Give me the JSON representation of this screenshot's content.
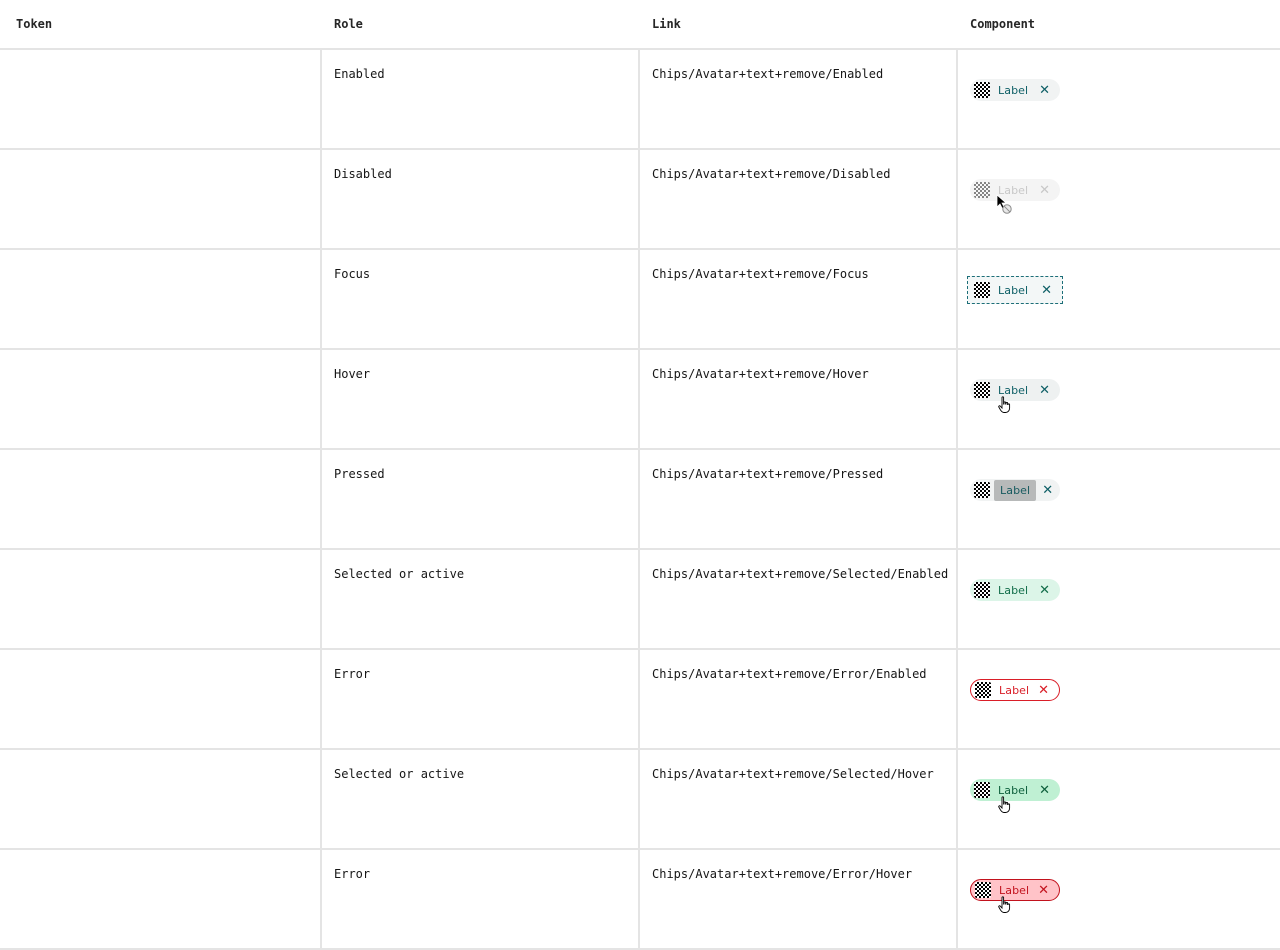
{
  "header": {
    "token": "Token",
    "role": "Role",
    "link": "Link",
    "component": "Component"
  },
  "rows": [
    {
      "token": "",
      "role": "Enabled",
      "link": "Chips/Avatar+text+remove/Enabled",
      "chip": {
        "label": "Label",
        "remove_icon": "close-icon",
        "avatar_icon": "checkerboard-avatar-icon",
        "state": "enabled"
      }
    },
    {
      "token": "",
      "role": "Disabled",
      "link": "Chips/Avatar+text+remove/Disabled",
      "chip": {
        "label": "Label",
        "remove_icon": "close-icon",
        "avatar_icon": "checkerboard-avatar-icon",
        "state": "disabled",
        "cursor": "not-allowed-cursor"
      }
    },
    {
      "token": "",
      "role": "Focus",
      "link": "Chips/Avatar+text+remove/Focus",
      "chip": {
        "label": "Label",
        "remove_icon": "close-icon",
        "avatar_icon": "checkerboard-avatar-icon",
        "state": "focus"
      }
    },
    {
      "token": "",
      "role": "Hover",
      "link": "Chips/Avatar+text+remove/Hover",
      "chip": {
        "label": "Label",
        "remove_icon": "close-icon",
        "avatar_icon": "checkerboard-avatar-icon",
        "state": "hover",
        "cursor": "hand-pointer-cursor"
      }
    },
    {
      "token": "",
      "role": "Pressed",
      "link": "Chips/Avatar+text+remove/Pressed",
      "chip": {
        "label": "Label",
        "remove_icon": "close-icon",
        "avatar_icon": "checkerboard-avatar-icon",
        "state": "pressed"
      }
    },
    {
      "token": "",
      "role": "Selected or active",
      "link": "Chips/Avatar+text+remove/Selected/Enabled",
      "chip": {
        "label": "Label",
        "remove_icon": "close-icon",
        "avatar_icon": "checkerboard-avatar-icon",
        "state": "selected"
      }
    },
    {
      "token": "",
      "role": "Error",
      "link": "Chips/Avatar+text+remove/Error/Enabled",
      "chip": {
        "label": "Label",
        "remove_icon": "close-icon",
        "avatar_icon": "checkerboard-avatar-icon",
        "state": "error"
      }
    },
    {
      "token": "",
      "role": "Selected or active",
      "link": "Chips/Avatar+text+remove/Selected/Hover",
      "chip": {
        "label": "Label",
        "remove_icon": "close-icon",
        "avatar_icon": "checkerboard-avatar-icon",
        "state": "selected-hover",
        "cursor": "hand-pointer-cursor"
      }
    },
    {
      "token": "",
      "role": "Error",
      "link": "Chips/Avatar+text+remove/Error/Hover",
      "chip": {
        "label": "Label",
        "remove_icon": "close-icon",
        "avatar_icon": "checkerboard-avatar-icon",
        "state": "error-hover",
        "cursor": "hand-pointer-cursor"
      }
    }
  ],
  "colors": {
    "border": "#e4e4e4",
    "chip_text_teal": "#0e5f66",
    "selected_bg": "#dcf5e8",
    "selected_hover_bg": "#bff0d3",
    "error_red": "#da1e28",
    "error_hover_bg": "#ffc3c8"
  }
}
